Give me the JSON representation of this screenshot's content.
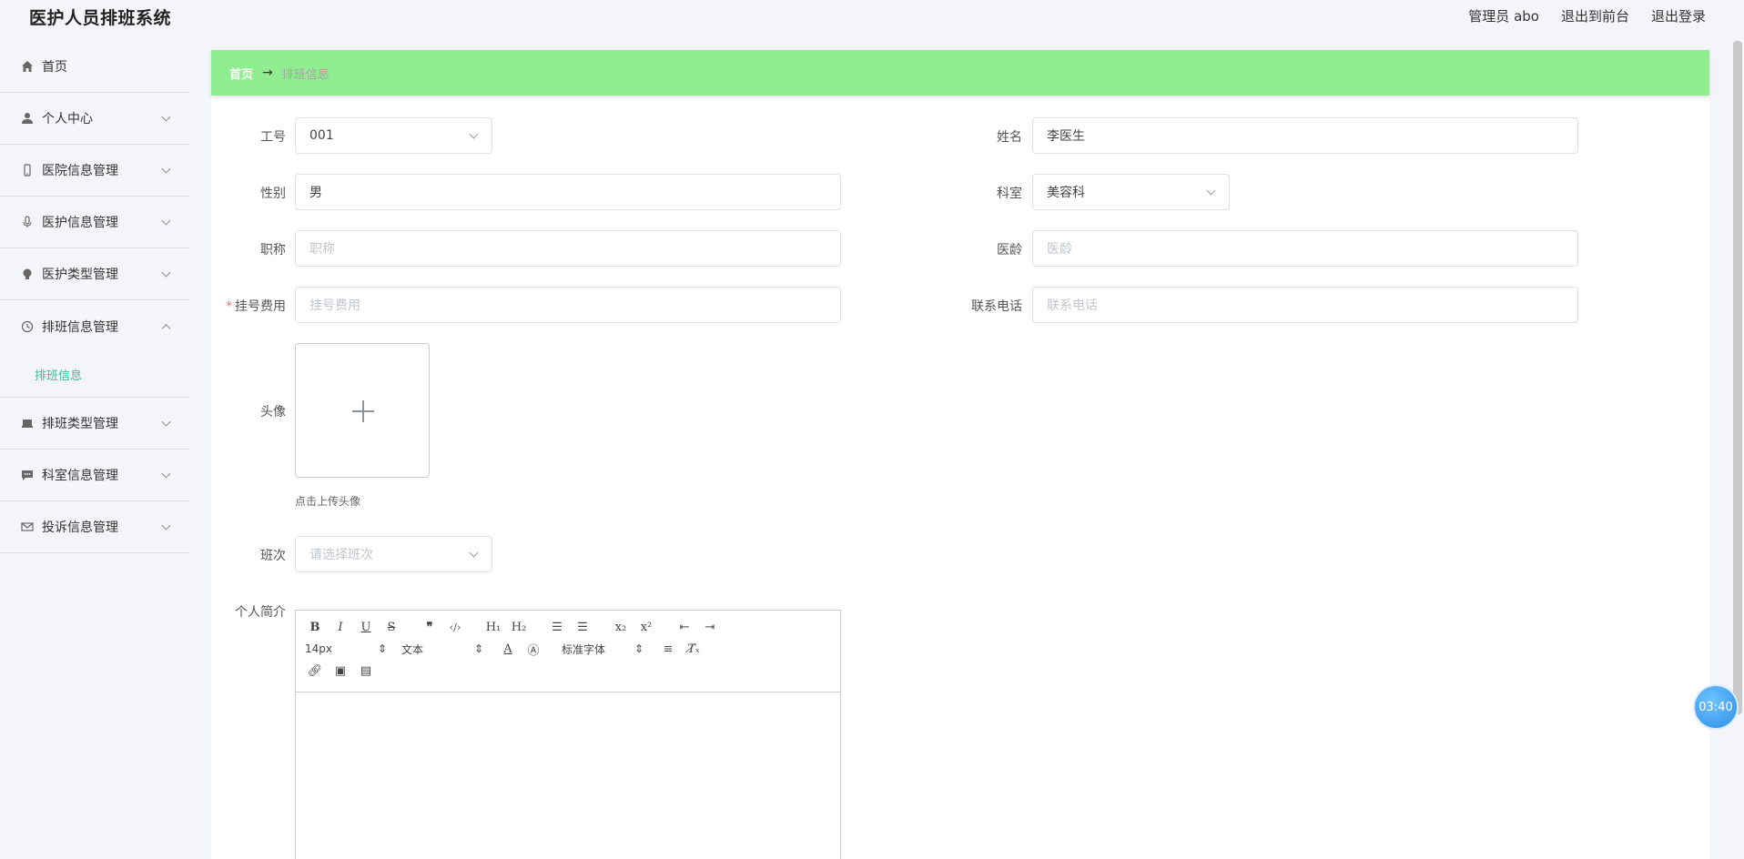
{
  "app": {
    "title": "医护人员排班系统"
  },
  "topnav": {
    "user": "管理员 abo",
    "front": "退出到前台",
    "logout": "退出登录"
  },
  "sidebar": {
    "items": [
      {
        "label": "首页",
        "icon": "home-icon"
      },
      {
        "label": "个人中心",
        "icon": "user-icon"
      },
      {
        "label": "医院信息管理",
        "icon": "phone-icon"
      },
      {
        "label": "医护信息管理",
        "icon": "microphone-icon"
      },
      {
        "label": "医护类型管理",
        "icon": "bulb-icon"
      },
      {
        "label": "排班信息管理",
        "icon": "clock-icon"
      },
      {
        "label": "排班类型管理",
        "icon": "box-icon"
      },
      {
        "label": "科室信息管理",
        "icon": "chat-icon"
      },
      {
        "label": "投诉信息管理",
        "icon": "mail-icon"
      }
    ],
    "submenu": {
      "label": "排班信息"
    }
  },
  "breadcrumb": {
    "home": "首页",
    "separator": "→",
    "current": "排班信息"
  },
  "form": {
    "job_no": {
      "label": "工号",
      "value": "001"
    },
    "name": {
      "label": "姓名",
      "value": "李医生"
    },
    "gender": {
      "label": "性别",
      "value": "男"
    },
    "dept": {
      "label": "科室",
      "value": "美容科"
    },
    "title": {
      "label": "职称",
      "placeholder": "职称"
    },
    "seniority": {
      "label": "医龄",
      "placeholder": "医龄"
    },
    "fee": {
      "label": "挂号费用",
      "required_mark": "*",
      "placeholder": "挂号费用"
    },
    "phone": {
      "label": "联系电话",
      "placeholder": "联系电话"
    },
    "avatar": {
      "label": "头像",
      "tip": "点击上传头像"
    },
    "shift": {
      "label": "班次",
      "placeholder": "请选择班次"
    },
    "intro": {
      "label": "个人简介"
    }
  },
  "editor": {
    "size": "14px",
    "format": "文本",
    "font": "标准字体"
  },
  "timer": {
    "text": "03:40"
  },
  "colors": {
    "breadcrumb_bg": "#90ee90",
    "accent": "#3bb89a",
    "required": "#f56c6c"
  }
}
